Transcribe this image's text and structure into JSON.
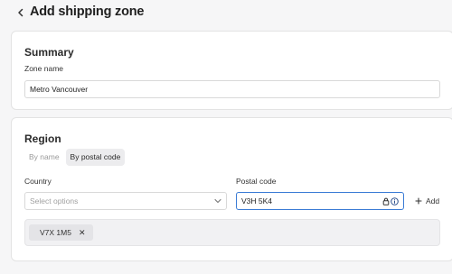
{
  "header": {
    "title": "Add shipping zone"
  },
  "summary": {
    "title": "Summary",
    "zone_name_label": "Zone name",
    "zone_name_value": "Metro Vancouver"
  },
  "region": {
    "title": "Region",
    "tabs": [
      {
        "label": "By name",
        "active": false
      },
      {
        "label": "By postal code",
        "active": true
      }
    ],
    "country_label": "Country",
    "country_placeholder": "Select options",
    "postal_label": "Postal code",
    "postal_value": "V3H 5K4",
    "add_label": "Add",
    "tags": [
      "V7X 1M5"
    ]
  },
  "colors": {
    "focus_border": "#3a7bd5",
    "active_tab_bg": "#ececee",
    "page_bg": "#f6f6f7"
  },
  "icons": {
    "back": "chevron-left-icon",
    "dropdown": "chevron-down-icon",
    "add": "plus-icon",
    "remove": "close-icon",
    "password_manager": "lock-icon",
    "info": "info-icon"
  }
}
